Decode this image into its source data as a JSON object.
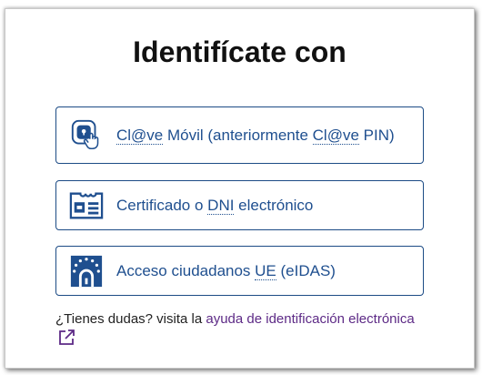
{
  "title": "Identifícate con",
  "options": [
    {
      "icon": "clave-movil-icon",
      "parts": [
        "Cl@ve",
        " Móvil (anteriormente ",
        "Cl@ve",
        " PIN)"
      ]
    },
    {
      "icon": "dni-card-icon",
      "parts": [
        "Certificado o ",
        "DNI",
        " electrónico"
      ]
    },
    {
      "icon": "eu-flag-lock-icon",
      "parts": [
        "Acceso ciudadanos ",
        "UE",
        " (eIDAS)"
      ]
    }
  ],
  "help": {
    "prefix": "¿Tienes dudas? visita la ",
    "link": "ayuda de identificación electrónica",
    "icon": "external-link-icon"
  },
  "colors": {
    "accent": "#1f4f8f",
    "border": "#1c4b85",
    "link": "#5d2a86"
  }
}
